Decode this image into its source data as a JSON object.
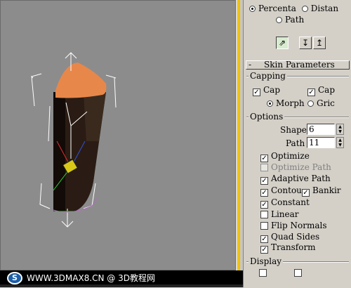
{
  "path_params": {
    "opt_percentage": "Percenta",
    "opt_distance": "Distan",
    "opt_path": "Path"
  },
  "skin_parameters": {
    "rollout_marker": "-",
    "title": "Skin Parameters",
    "capping": {
      "label": "Capping",
      "cap_start": "Cap",
      "cap_end": "Cap",
      "morph": "Morph",
      "grid": "Griс"
    },
    "options": {
      "label": "Options",
      "shape_label": "Shape",
      "shape_value": "6",
      "path_label": "Path",
      "path_value": "11",
      "optimize": "Optimize",
      "optimize_path": "Optimize Path",
      "adaptive_path": "Adaptive Path",
      "contour": "Contou",
      "banking": "Bankir",
      "constant": "Constant",
      "linear": "Linear",
      "flip_normals": "Flip Normals",
      "quad_sides": "Quad Sides",
      "transform": "Transform"
    },
    "display": {
      "label": "Display"
    }
  },
  "watermark": {
    "logo": "S",
    "text": "WWW.3DMAX8.CN @ 3D教程网"
  }
}
